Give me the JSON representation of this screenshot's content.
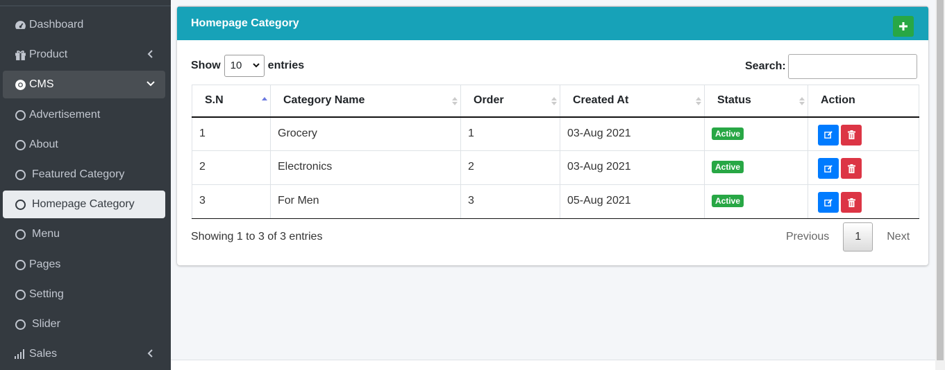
{
  "sidebar": {
    "items": [
      {
        "label": "Dashboard",
        "icon": "dashboard-icon"
      },
      {
        "label": "Product",
        "icon": "gift-icon"
      },
      {
        "label": "CMS",
        "icon": "chrome-icon"
      },
      {
        "label": "Advertisement",
        "icon": "circle-icon"
      },
      {
        "label": "About",
        "icon": "circle-icon"
      },
      {
        "label": "Featured Category",
        "icon": "circle-icon"
      },
      {
        "label": "Homepage Category",
        "icon": "circle-icon"
      },
      {
        "label": "Menu",
        "icon": "circle-icon"
      },
      {
        "label": "Pages",
        "icon": "circle-icon"
      },
      {
        "label": "Setting",
        "icon": "circle-icon"
      },
      {
        "label": "Slider",
        "icon": "circle-icon"
      },
      {
        "label": "Sales",
        "icon": "signal-icon"
      }
    ]
  },
  "card": {
    "title": "Homepage Category"
  },
  "controls": {
    "show_label": "Show",
    "entries_value": "10",
    "entries_label": "entries",
    "search_label": "Search:",
    "search_value": ""
  },
  "table": {
    "columns": [
      "S.N",
      "Category Name",
      "Order",
      "Created At",
      "Status",
      "Action"
    ],
    "rows": [
      {
        "sn": "1",
        "name": "Grocery",
        "order": "1",
        "created": "03-Aug 2021",
        "status": "Active"
      },
      {
        "sn": "2",
        "name": "Electronics",
        "order": "2",
        "created": "03-Aug 2021",
        "status": "Active"
      },
      {
        "sn": "3",
        "name": "For Men",
        "order": "3",
        "created": "05-Aug 2021",
        "status": "Active"
      }
    ]
  },
  "footer": {
    "info": "Showing 1 to 3 of 3 entries",
    "previous": "Previous",
    "current_page": "1",
    "next": "Next"
  },
  "colors": {
    "sidebar_bg": "#343a40",
    "header_bg": "#17a2b8",
    "add_button": "#28a745",
    "edit_button": "#007bff",
    "delete_button": "#dc3545",
    "badge_active": "#28a745"
  }
}
